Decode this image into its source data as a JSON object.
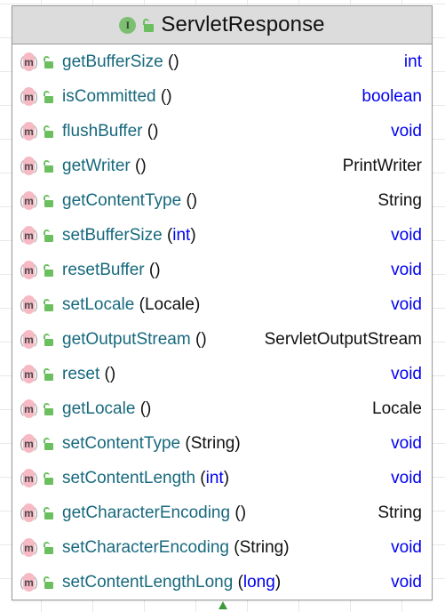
{
  "diagram": {
    "kind": "uml-class-diagram",
    "class": {
      "name": "ServletResponse",
      "stereotype_badge": "I",
      "stereotype": "interface",
      "visibility_icon": "open-padlock-icon",
      "header_bg": "#dcdcdc",
      "border_color": "#9a9a9a"
    },
    "colors": {
      "method_name": "#17697d",
      "primitive_type": "#0000ee",
      "object_type": "#101010",
      "method_icon": "#f7b9c4",
      "padlock": "#6cbf5e",
      "interface_badge": "#7dbf72",
      "connector_arrow": "#3c9a3c"
    },
    "members": [
      {
        "icon": "method-icon",
        "visibility_icon": "open-padlock-icon",
        "name": "getBufferSize",
        "open": "(",
        "param": "",
        "param_kind": "none",
        "close": ")",
        "return": "int",
        "return_kind": "primitive"
      },
      {
        "icon": "method-icon",
        "visibility_icon": "open-padlock-icon",
        "name": "isCommitted",
        "open": "(",
        "param": "",
        "param_kind": "none",
        "close": ")",
        "return": "boolean",
        "return_kind": "primitive"
      },
      {
        "icon": "method-icon",
        "visibility_icon": "open-padlock-icon",
        "name": "flushBuffer",
        "open": "(",
        "param": "",
        "param_kind": "none",
        "close": ")",
        "return": "void",
        "return_kind": "primitive"
      },
      {
        "icon": "method-icon",
        "visibility_icon": "open-padlock-icon",
        "name": "getWriter",
        "open": "(",
        "param": "",
        "param_kind": "none",
        "close": ")",
        "return": "PrintWriter",
        "return_kind": "object"
      },
      {
        "icon": "method-icon",
        "visibility_icon": "open-padlock-icon",
        "name": "getContentType",
        "open": "(",
        "param": "",
        "param_kind": "none",
        "close": ")",
        "return": "String",
        "return_kind": "object"
      },
      {
        "icon": "method-icon",
        "visibility_icon": "open-padlock-icon",
        "name": "setBufferSize",
        "open": "(",
        "param": "int",
        "param_kind": "primitive",
        "close": ")",
        "return": "void",
        "return_kind": "primitive"
      },
      {
        "icon": "method-icon",
        "visibility_icon": "open-padlock-icon",
        "name": "resetBuffer",
        "open": "(",
        "param": "",
        "param_kind": "none",
        "close": ")",
        "return": "void",
        "return_kind": "primitive"
      },
      {
        "icon": "method-icon",
        "visibility_icon": "open-padlock-icon",
        "name": "setLocale",
        "open": "(",
        "param": "Locale",
        "param_kind": "object",
        "close": ")",
        "return": "void",
        "return_kind": "primitive"
      },
      {
        "icon": "method-icon",
        "visibility_icon": "open-padlock-icon",
        "name": "getOutputStream",
        "open": "(",
        "param": "",
        "param_kind": "none",
        "close": ")",
        "return": "ServletOutputStream",
        "return_kind": "object"
      },
      {
        "icon": "method-icon",
        "visibility_icon": "open-padlock-icon",
        "name": "reset",
        "open": "(",
        "param": "",
        "param_kind": "none",
        "close": ")",
        "return": "void",
        "return_kind": "primitive"
      },
      {
        "icon": "method-icon",
        "visibility_icon": "open-padlock-icon",
        "name": "getLocale",
        "open": "(",
        "param": "",
        "param_kind": "none",
        "close": ")",
        "return": "Locale",
        "return_kind": "object"
      },
      {
        "icon": "method-icon",
        "visibility_icon": "open-padlock-icon",
        "name": "setContentType",
        "open": "(",
        "param": "String",
        "param_kind": "object",
        "close": ")",
        "return": "void",
        "return_kind": "primitive"
      },
      {
        "icon": "method-icon",
        "visibility_icon": "open-padlock-icon",
        "name": "setContentLength",
        "open": "(",
        "param": "int",
        "param_kind": "primitive",
        "close": ")",
        "return": "void",
        "return_kind": "primitive"
      },
      {
        "icon": "method-icon",
        "visibility_icon": "open-padlock-icon",
        "name": "getCharacterEncoding",
        "open": "(",
        "param": "",
        "param_kind": "none",
        "close": ")",
        "return": "String",
        "return_kind": "object"
      },
      {
        "icon": "method-icon",
        "visibility_icon": "open-padlock-icon",
        "name": "setCharacterEncoding",
        "open": "(",
        "param": "String",
        "param_kind": "object",
        "close": ")",
        "return": "void",
        "return_kind": "primitive"
      },
      {
        "icon": "method-icon",
        "visibility_icon": "open-padlock-icon",
        "name": "setContentLengthLong",
        "open": "(",
        "param": "long",
        "param_kind": "primitive",
        "close": ")",
        "return": "void",
        "return_kind": "primitive"
      }
    ],
    "connector": {
      "name": "inheritance-arrow",
      "direction": "up"
    }
  }
}
